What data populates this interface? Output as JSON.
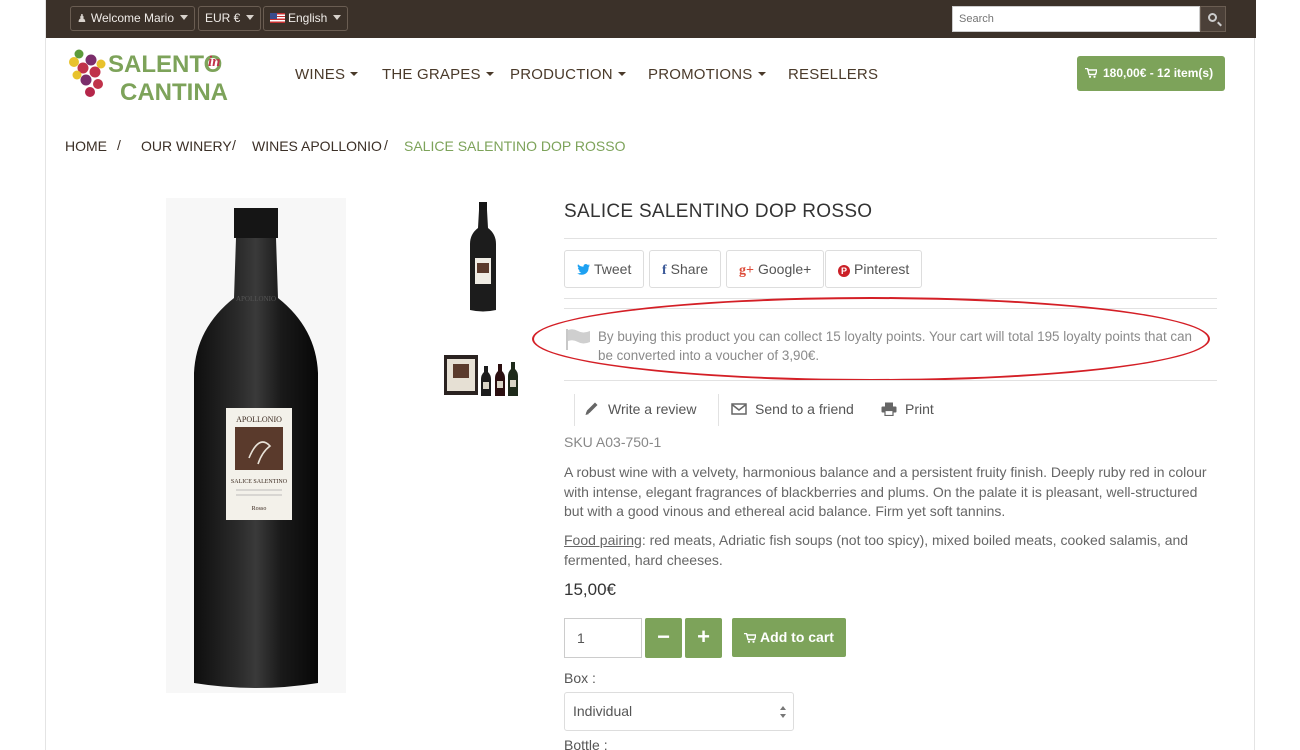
{
  "topbar": {
    "welcome": "Welcome Mario",
    "currency": "EUR €",
    "language": "English",
    "search_placeholder": "Search"
  },
  "brand": {
    "line1": "SALENTO",
    "line1_suffix": "in",
    "line2": "CANTINA",
    "colors": {
      "green": "#7da35a",
      "grape_red": "#c0324a",
      "grape_purple": "#7b2d6b",
      "grape_yellow": "#e8c22c",
      "leaf_green": "#5c9a3a"
    }
  },
  "nav": {
    "wines": "WINES",
    "grapes": "THE GRAPES",
    "production": "PRODUCTION",
    "promotions": "PROMOTIONS",
    "resellers": "RESELLERS"
  },
  "cart": {
    "label": "180,00€ - 12 item(s)"
  },
  "breadcrumb": {
    "home": "HOME",
    "winery": "OUR WINERY",
    "wines": "WINES APOLLONIO",
    "current": "SALICE SALENTINO DOP ROSSO",
    "separator": "/"
  },
  "bottle_label": {
    "brand": "APOLLONIO",
    "name": "SALICE SALENTINO",
    "type": "Rosso"
  },
  "product": {
    "title": "SALICE SALENTINO DOP ROSSO",
    "share": {
      "tweet": "Tweet",
      "share": "Share",
      "google": "Google+",
      "pinterest": "Pinterest",
      "google_icon": "g+",
      "facebook_icon": "f",
      "pinterest_icon": "P"
    },
    "loyalty_text": "By buying this product you can collect 15 loyalty points. Your cart will total 195 loyalty points that can be converted into a voucher of 3,90€.",
    "actions": {
      "review": "Write a review",
      "send": "Send to a friend",
      "print": "Print"
    },
    "sku": "SKU A03-750-1",
    "description": "A robust wine with a velvety, harmonious balance and a persistent fruity finish. Deeply ruby red in colour with intense, elegant fragrances of blackberries and plums. On the palate it is pleasant, well-structured but with a good vinous and ethereal acid balance. Firm yet soft tannins.",
    "food_label": "Food pairing",
    "food_text": ": red meats, Adriatic fish soups (not too spicy), mixed boiled meats, cooked salamis, and fermented, hard cheeses.",
    "price": "15,00€",
    "quantity": "1",
    "minus": "−",
    "plus": "+",
    "add_to_cart": "Add to cart",
    "box_label": "Box :",
    "box_value": "Individual",
    "bottle_label": "Bottle :"
  },
  "highlight_color": "#d41f26"
}
